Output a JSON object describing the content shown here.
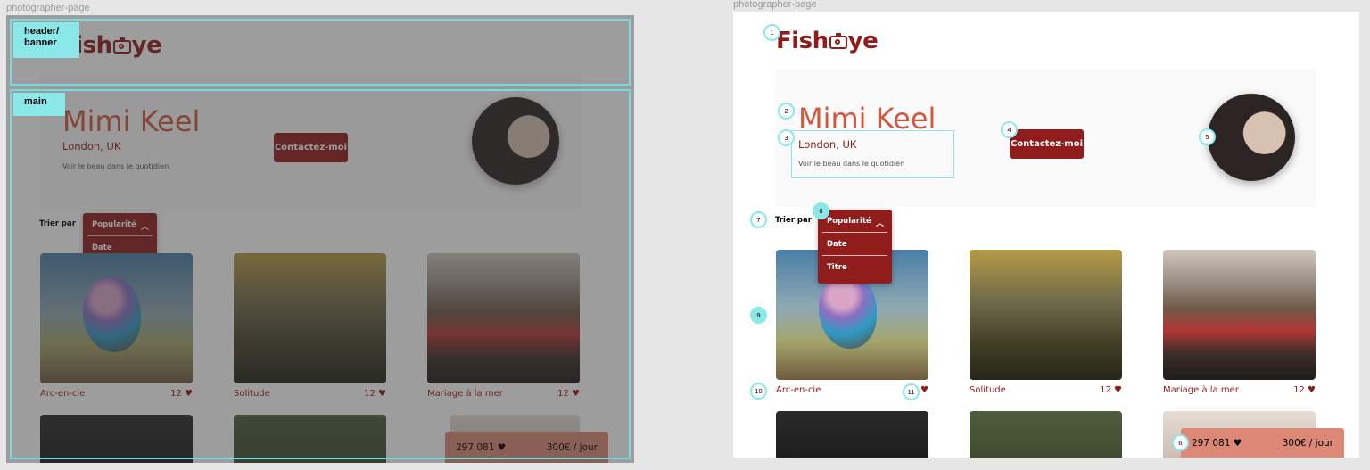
{
  "frames": {
    "left_title": "photographer-page",
    "right_title": "photographer-page"
  },
  "landmarks": {
    "header": "header/\nbanner",
    "main": "main"
  },
  "logo": {
    "prefix": "Fish",
    "suffix": "ye",
    "icon": "camera-icon"
  },
  "photographer": {
    "name": "Mimi Keel",
    "location": "London, UK",
    "tagline": "Voir le beau dans le quotidien",
    "contact_label": "Contactez-moi"
  },
  "sort": {
    "label": "Trier par",
    "options": [
      "Popularité",
      "Date",
      "Titre"
    ],
    "selected": "Popularité"
  },
  "media": [
    {
      "title": "Arc-en-cie",
      "likes": "12"
    },
    {
      "title": "Solitude",
      "likes": "12"
    },
    {
      "title": "Mariage à la mer",
      "likes": "12"
    }
  ],
  "stats": {
    "likes": "297 081",
    "rate": "300€ / jour"
  },
  "focus_order": [
    "1",
    "2",
    "3",
    "4",
    "5",
    "6",
    "7",
    "8",
    "9",
    "10",
    "11"
  ],
  "colors": {
    "primary": "#901c1c",
    "accent": "#d3573c",
    "price_bg": "#db8876",
    "annotation": "#8be8e8"
  }
}
